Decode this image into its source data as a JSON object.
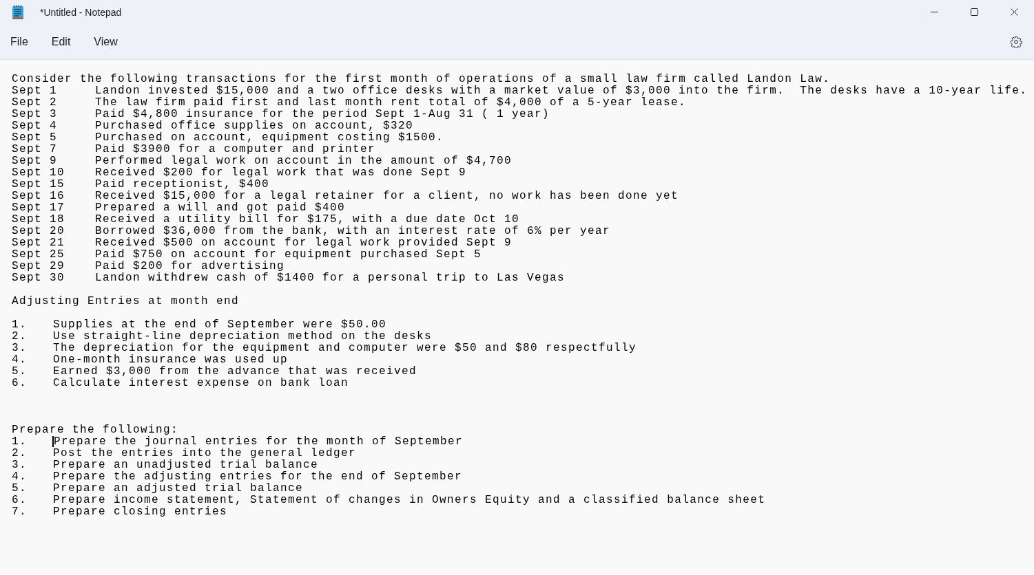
{
  "window": {
    "title": "*Untitled - Notepad"
  },
  "menu": [
    "File",
    "Edit",
    "View"
  ],
  "document": {
    "intro": "Consider the following transactions for the first month of operations of a small law firm called Landon Law.",
    "transactions": [
      {
        "date": "Sept 1",
        "text": "Landon invested $15,000 and a two office desks with a market value of $3,000 into the firm.  The desks have a 10-year life."
      },
      {
        "date": "Sept 2",
        "text": "The law firm paid first and last month rent total of $4,000 of a 5-year lease."
      },
      {
        "date": "Sept 3",
        "text": "Paid $4,800 insurance for the period Sept 1-Aug 31 ( 1 year)"
      },
      {
        "date": "Sept 4",
        "text": "Purchased office supplies on account, $320"
      },
      {
        "date": "Sept 5",
        "text": "Purchased on account, equipment costing $1500."
      },
      {
        "date": "Sept 7",
        "text": "Paid $3900 for a computer and printer"
      },
      {
        "date": "Sept 9",
        "text": "Performed legal work on account in the amount of $4,700"
      },
      {
        "date": "Sept 10",
        "text": "Received $200 for legal work that was done Sept 9"
      },
      {
        "date": "Sept 15",
        "text": "Paid receptionist, $400"
      },
      {
        "date": "Sept 16",
        "text": "Received $15,000 for a legal retainer for a client, no work has been done yet"
      },
      {
        "date": "Sept 17",
        "text": "Prepared a will and got paid $400"
      },
      {
        "date": "Sept 18",
        "text": "Received a utility bill for $175, with a due date Oct 10"
      },
      {
        "date": "Sept 20",
        "text": "Borrowed $36,000 from the bank, with an interest rate of 6% per year"
      },
      {
        "date": "Sept 21",
        "text": "Received $500 on account for legal work provided Sept 9"
      },
      {
        "date": "Sept 25",
        "text": "Paid $750 on account for equipment purchased Sept 5"
      },
      {
        "date": "Sept 29",
        "text": "Paid $200 for advertising"
      },
      {
        "date": "Sept 30",
        "text": "Landon withdrew cash of $1400 for a personal trip to Las Vegas"
      }
    ],
    "adjusting_heading": "Adjusting Entries at month end",
    "adjustments": [
      {
        "number": "1.",
        "text": "Supplies at the end of September were $50.00"
      },
      {
        "number": "2.",
        "text": "Use straight-line depreciation method on the desks"
      },
      {
        "number": "3.",
        "text": "The depreciation for the equipment and computer were $50 and $80 respectfully"
      },
      {
        "number": "4.",
        "text": "One-month insurance was used up"
      },
      {
        "number": "5.",
        "text": "Earned $3,000 from the advance that was received"
      },
      {
        "number": "6.",
        "text": "Calculate interest expense on bank loan"
      }
    ],
    "prepare_heading": "Prepare the following:",
    "tasks": [
      {
        "number": "1.",
        "text": "Prepare the journal entries for the month of September",
        "caret": true
      },
      {
        "number": "2.",
        "text": "Post the entries into the general ledger",
        "caret": false
      },
      {
        "number": "3.",
        "text": "Prepare an unadjusted trial balance",
        "caret": false
      },
      {
        "number": "4.",
        "text": "Prepare the adjusting entries for the end of September",
        "caret": false
      },
      {
        "number": "5.",
        "text": "Prepare an adjusted trial balance",
        "caret": false
      },
      {
        "number": "6.",
        "text": "Prepare income statement, Statement of changes in Owners Equity and a classified balance sheet",
        "caret": false
      },
      {
        "number": "7.",
        "text": "Prepare closing entries",
        "caret": false
      }
    ]
  }
}
